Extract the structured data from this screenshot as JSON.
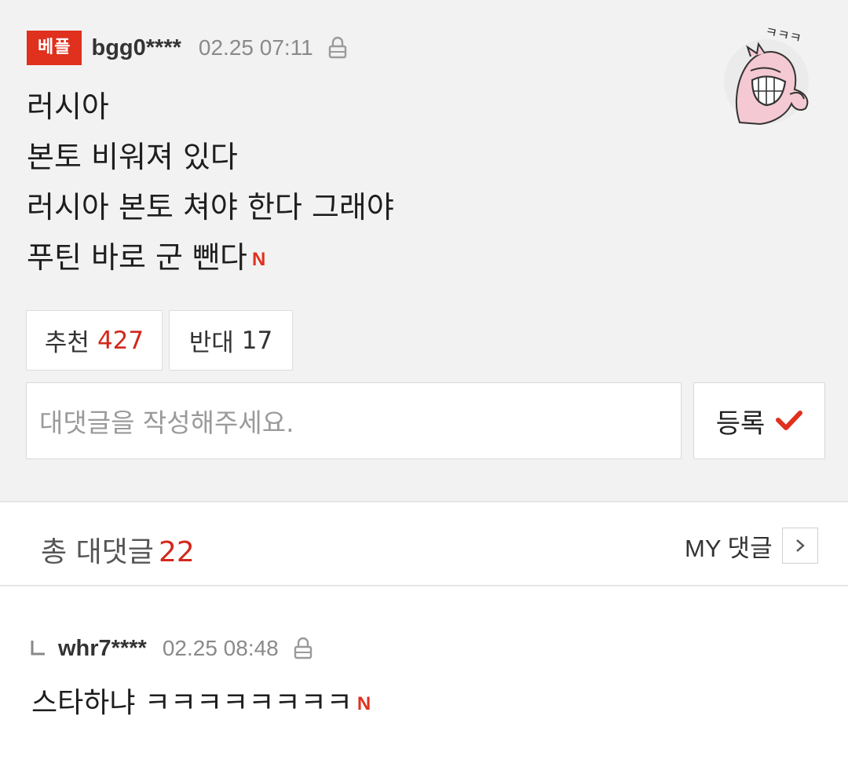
{
  "comment": {
    "badge": "베플",
    "username": "bgg0****",
    "timestamp": "02.25 07:11",
    "sticker_text": "ㅋㅋㅋ",
    "lines": [
      "러시아",
      "본토 비워져 있다",
      "러시아 본토 쳐야 한다 그래야",
      "푸틴 바로 군 뺀다"
    ],
    "new_marker": "N",
    "upvote_label": "추천",
    "upvote_count": "427",
    "downvote_label": "반대",
    "downvote_count": "17"
  },
  "reply_form": {
    "placeholder": "대댓글을 작성해주세요.",
    "submit_label": "등록"
  },
  "reply_summary": {
    "label": "총 대댓글",
    "count": "22",
    "my_replies_label": "MY 댓글"
  },
  "replies": [
    {
      "username": "whr7****",
      "timestamp": "02.25 08:48",
      "text": "스타하냐 ㅋㅋㅋㅋㅋㅋㅋㅋ",
      "new_marker": "N"
    }
  ],
  "colors": {
    "accent": "#e0301e",
    "count_red": "#d2281c",
    "panel_bg": "#f2f2f2"
  },
  "icons": [
    "lock-icon",
    "sticker-laughing-character",
    "checkmark-icon",
    "chevron-right-icon",
    "reply-arrow-icon"
  ]
}
